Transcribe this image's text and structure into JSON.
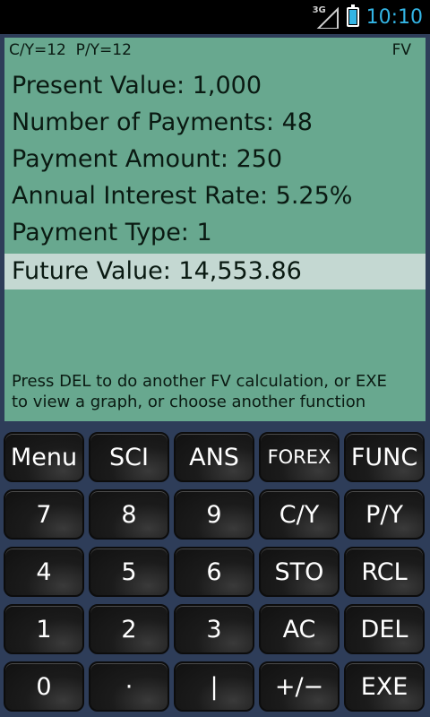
{
  "status": {
    "network": "3G",
    "time": "10:10"
  },
  "display": {
    "cy": "C/Y=12",
    "py": "P/Y=12",
    "mode": "FV",
    "rows": [
      {
        "label": "Present Value: 1,000"
      },
      {
        "label": "Number of Payments: 48"
      },
      {
        "label": "Payment Amount: 250"
      },
      {
        "label": "Annual Interest Rate: 5.25%"
      },
      {
        "label": "Payment Type: 1"
      },
      {
        "label": "Future Value: 14,553.86"
      }
    ],
    "help": "Press DEL to do another FV calculation, or EXE to view a graph, or choose another function"
  },
  "keys": [
    [
      "Menu",
      "SCI",
      "ANS",
      "FOREX",
      "FUNC"
    ],
    [
      "7",
      "8",
      "9",
      "C/Y",
      "P/Y"
    ],
    [
      "4",
      "5",
      "6",
      "STO",
      "RCL"
    ],
    [
      "1",
      "2",
      "3",
      "AC",
      "DEL"
    ],
    [
      "0",
      "·",
      "|",
      "+/−",
      "EXE"
    ]
  ]
}
